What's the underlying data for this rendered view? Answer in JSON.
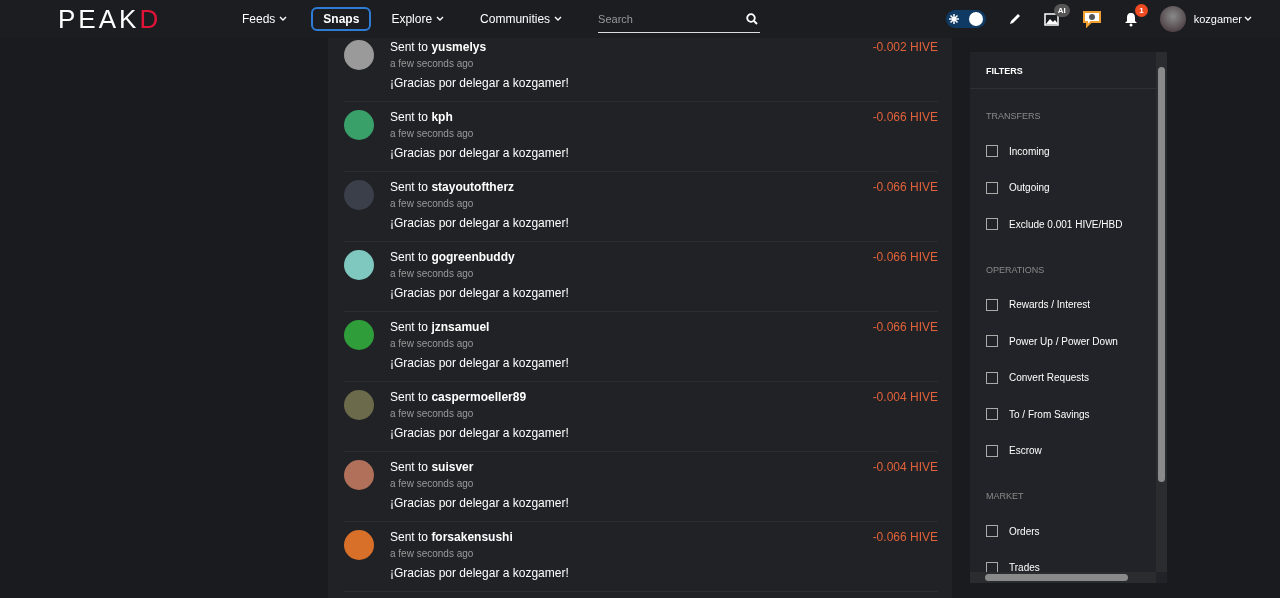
{
  "header": {
    "logo": {
      "text": "PEAK",
      "accent": "D"
    },
    "nav": [
      {
        "label": "Feeds",
        "selected": false,
        "dropdown": true
      },
      {
        "label": "Snaps",
        "selected": true,
        "dropdown": false
      },
      {
        "label": "Explore",
        "selected": false,
        "dropdown": true
      },
      {
        "label": "Communities",
        "selected": false,
        "dropdown": true
      }
    ],
    "search": {
      "placeholder": "Search"
    },
    "theme_toggle": {
      "on": true
    },
    "ai_badge": "AI",
    "notifications": "1",
    "user": "kozgamer"
  },
  "transactions": [
    {
      "text": "Sent to **yusmelys**",
      "time": "a few seconds ago",
      "memo": "¡Gracias por delegar a kozgamer!",
      "amount": "-0.002 HIVE",
      "color": "#9a9a9a"
    },
    {
      "text": "Sent to **kph**",
      "time": "a few seconds ago",
      "memo": "¡Gracias por delegar a kozgamer!",
      "amount": "-0.066 HIVE",
      "color": "#3aa06a"
    },
    {
      "text": "Sent to **stayoutoftherz**",
      "time": "a few seconds ago",
      "memo": "¡Gracias por delegar a kozgamer!",
      "amount": "-0.066 HIVE",
      "color": "#3a3f4a"
    },
    {
      "text": "Sent to **gogreenbuddy**",
      "time": "a few seconds ago",
      "memo": "¡Gracias por delegar a kozgamer!",
      "amount": "-0.066 HIVE",
      "color": "#7fc8c0"
    },
    {
      "text": "Sent to **jznsamuel**",
      "time": "a few seconds ago",
      "memo": "¡Gracias por delegar a kozgamer!",
      "amount": "-0.066 HIVE",
      "color": "#2f9e3a"
    },
    {
      "text": "Sent to **caspermoeller89**",
      "time": "a few seconds ago",
      "memo": "¡Gracias por delegar a kozgamer!",
      "amount": "-0.004 HIVE",
      "color": "#6b6a4a"
    },
    {
      "text": "Sent to **suisver**",
      "time": "a few seconds ago",
      "memo": "¡Gracias por delegar a kozgamer!",
      "amount": "-0.004 HIVE",
      "color": "#b0705a"
    },
    {
      "text": "Sent to **forsakensushi**",
      "time": "a few seconds ago",
      "memo": "¡Gracias por delegar a kozgamer!",
      "amount": "-0.066 HIVE",
      "color": "#d8702a"
    }
  ],
  "filters": {
    "title": "FILTERS",
    "sections": [
      {
        "title": "TRANSFERS",
        "items": [
          {
            "label": "Incoming",
            "checked": false
          },
          {
            "label": "Outgoing",
            "checked": false
          },
          {
            "label": "Exclude 0.001 HIVE/HBD",
            "checked": false
          }
        ]
      },
      {
        "title": "OPERATIONS",
        "items": [
          {
            "label": "Rewards / Interest",
            "checked": false
          },
          {
            "label": "Power Up / Power Down",
            "checked": false
          },
          {
            "label": "Convert Requests",
            "checked": false
          },
          {
            "label": "To / From Savings",
            "checked": false
          },
          {
            "label": "Escrow",
            "checked": false
          }
        ]
      },
      {
        "title": "MARKET",
        "items": [
          {
            "label": "Orders",
            "checked": false
          },
          {
            "label": "Trades",
            "checked": false
          }
        ]
      }
    ]
  }
}
